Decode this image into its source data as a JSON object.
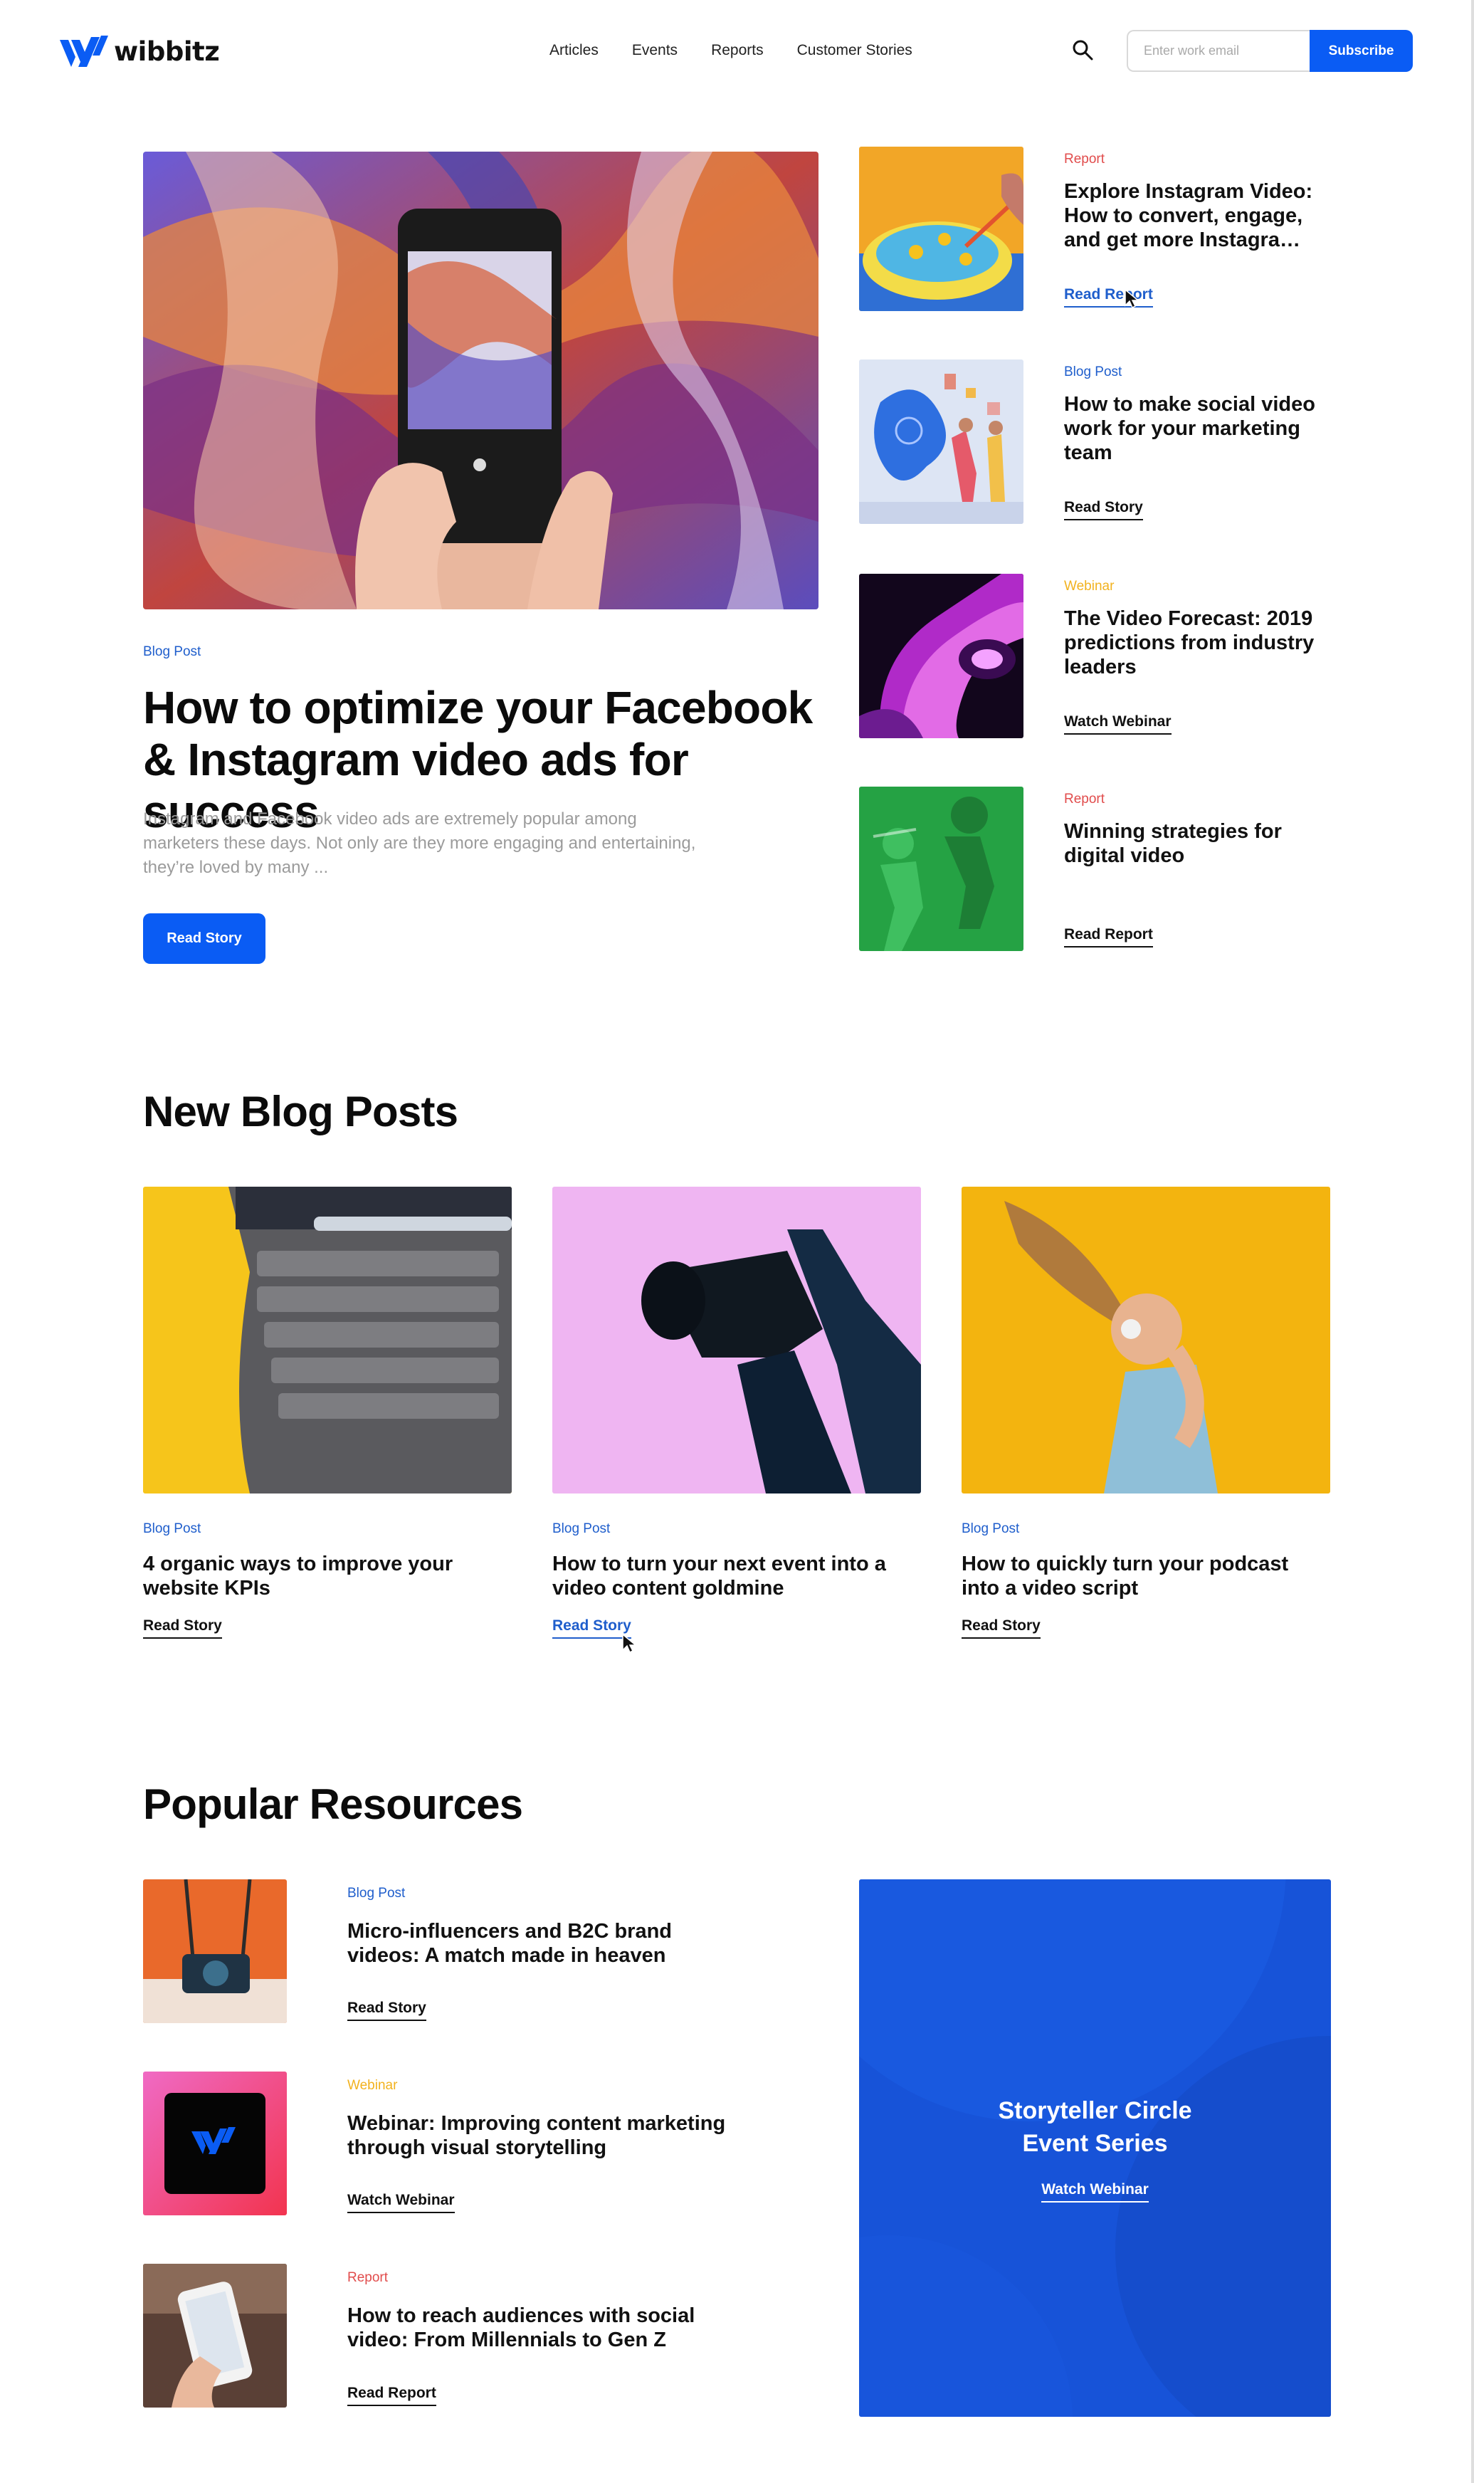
{
  "header": {
    "logo_text": "wibbitz",
    "nav": [
      "Articles",
      "Events",
      "Reports",
      "Customer Stories"
    ],
    "email_placeholder": "Enter work email",
    "subscribe_label": "Subscribe",
    "accent_color": "#0a5cf4"
  },
  "hero": {
    "tag": "Blog Post",
    "title": "How to optimize your Facebook & Instagram video ads for success",
    "excerpt": "Instagram and Facebook video ads are extremely popular among marketers these days. Not only are they more engaging and entertaining, they’re loved by many ...",
    "button_label": "Read Story"
  },
  "side_items": [
    {
      "tag": "Report",
      "title": "Explore Instagram Video: How to convert, engage, and get more Instagra…",
      "link": "Read Report"
    },
    {
      "tag": "Blog Post",
      "title": "How to make social video work for your marketing team",
      "link": "Read Story"
    },
    {
      "tag": "Webinar",
      "title": "The Video Forecast: 2019 predictions from industry leaders",
      "link": "Watch Webinar"
    },
    {
      "tag": "Report",
      "title": "Winning strategies for digital video",
      "link": "Read Report"
    }
  ],
  "new_posts": {
    "heading": "New Blog Posts",
    "cards": [
      {
        "tag": "Blog Post",
        "title": "4 organic ways to improve your website KPIs",
        "link": "Read Story"
      },
      {
        "tag": "Blog Post",
        "title": "How to turn your next event into a video content goldmine",
        "link": "Read Story"
      },
      {
        "tag": "Blog Post",
        "title": "How to quickly turn your podcast into a video script",
        "link": "Read Story"
      }
    ]
  },
  "popular": {
    "heading": "Popular Resources",
    "items": [
      {
        "tag": "Blog Post",
        "title": "Micro-influencers and B2C brand videos: A match made in heaven",
        "link": "Read Story"
      },
      {
        "tag": "Webinar",
        "title": "Webinar: Improving content marketing through visual storytelling",
        "link": "Watch Webinar"
      },
      {
        "tag": "Report",
        "title": "How to reach audiences with social video: From Millennials to Gen Z",
        "link": "Read Report"
      }
    ],
    "promo": {
      "title_line1": "Storyteller Circle",
      "title_line2": "Event Series",
      "link": "Watch Webinar"
    }
  }
}
